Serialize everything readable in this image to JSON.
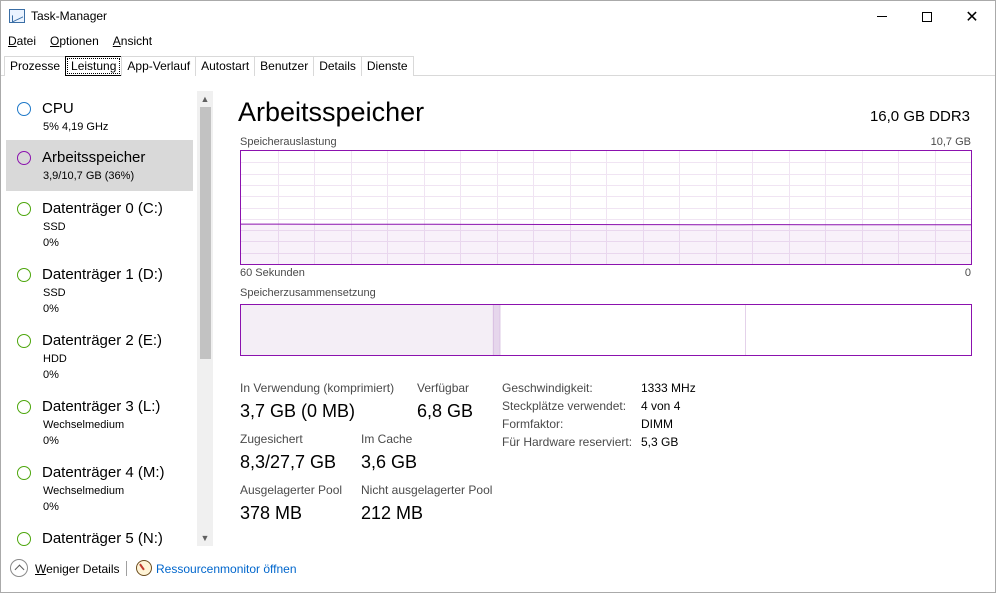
{
  "window": {
    "title": "Task-Manager",
    "icons": {
      "app": "task-manager-icon",
      "minimize": "minimize-icon",
      "maximize": "maximize-icon",
      "close": "close-icon"
    },
    "close_glyph": "✕"
  },
  "menu": [
    {
      "key": "D",
      "rest": "atei"
    },
    {
      "key": "O",
      "rest": "ptionen"
    },
    {
      "key": "A",
      "rest": "nsicht"
    }
  ],
  "tabs": [
    "Prozesse",
    "Leistung",
    "App-Verlauf",
    "Autostart",
    "Benutzer",
    "Details",
    "Dienste"
  ],
  "active_tab": "Leistung",
  "sidebar": {
    "items": [
      {
        "title": "CPU",
        "sub1": "5%  4,19 GHz",
        "sub2": "",
        "color": "#1e78c8"
      },
      {
        "title": "Arbeitsspeicher",
        "sub1": "3,9/10,7 GB (36%)",
        "sub2": "",
        "color": "#8b12ae",
        "selected": true
      },
      {
        "title": "Datenträger 0 (C:)",
        "sub1": "SSD",
        "sub2": "0%",
        "color": "#4da60c"
      },
      {
        "title": "Datenträger 1 (D:)",
        "sub1": "SSD",
        "sub2": "0%",
        "color": "#4da60c"
      },
      {
        "title": "Datenträger 2 (E:)",
        "sub1": "HDD",
        "sub2": "0%",
        "color": "#4da60c"
      },
      {
        "title": "Datenträger 3 (L:)",
        "sub1": "Wechselmedium",
        "sub2": "0%",
        "color": "#4da60c"
      },
      {
        "title": "Datenträger 4 (M:)",
        "sub1": "Wechselmedium",
        "sub2": "0%",
        "color": "#4da60c"
      },
      {
        "title": "Datenträger 5 (N:)",
        "sub1": "",
        "sub2": "",
        "color": "#4da60c"
      }
    ],
    "scroll_up_glyph": "▲",
    "scroll_down_glyph": "▼"
  },
  "main": {
    "title": "Arbeitsspeicher",
    "spec": "16,0 GB DDR3",
    "graph": {
      "label": "Speicherauslastung",
      "max_label": "10,7 GB",
      "time_label": "60 Sekunden",
      "zero_label": "0",
      "color": "#8b12ae",
      "usage_history_gb": [
        3.78,
        3.78,
        3.77,
        3.77,
        3.76,
        3.76,
        3.75,
        3.75,
        3.74,
        3.74,
        3.73,
        3.73,
        3.72,
        3.72,
        3.73,
        3.72,
        3.72,
        3.72,
        3.72,
        3.72
      ],
      "max_gb": 10.7
    },
    "composition": {
      "label": "Speicherzusammensetzung",
      "in_use_gb": 3.7,
      "modified_gb": 0.1,
      "standby_gb": 3.6,
      "free_gb": 3.2,
      "total_gb": 10.7
    },
    "stats": {
      "in_use_label": "In Verwendung (komprimiert)",
      "in_use_value": "3,7 GB (0 MB)",
      "available_label": "Verfügbar",
      "available_value": "6,8 GB",
      "committed_label": "Zugesichert",
      "committed_value": "8,3/27,7 GB",
      "cached_label": "Im Cache",
      "cached_value": "3,6 GB",
      "paged_label": "Ausgelagerter Pool",
      "paged_value": "378 MB",
      "nonpaged_label": "Nicht ausgelagerter Pool",
      "nonpaged_value": "212 MB"
    },
    "properties": [
      {
        "label": "Geschwindigkeit:",
        "value": "1333 MHz"
      },
      {
        "label": "Steckplätze verwendet:",
        "value": "4 von 4"
      },
      {
        "label": "Formfaktor:",
        "value": "DIMM"
      },
      {
        "label": "Für Hardware reserviert:",
        "value": "5,3 GB"
      }
    ]
  },
  "footer": {
    "less_details_key": "W",
    "less_details_rest": "eniger Details",
    "resmon_link": "Ressourcenmonitor öffnen"
  }
}
